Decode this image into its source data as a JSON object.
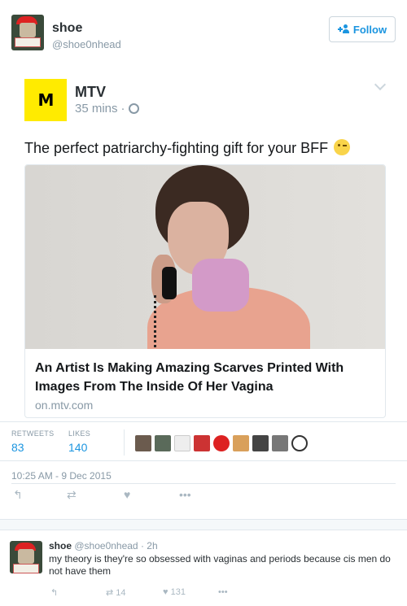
{
  "author": {
    "name": "shoe",
    "handle": "@shoe0nhead"
  },
  "follow_label": "Follow",
  "quoted": {
    "logo_text": "M",
    "name": "MTV",
    "time": "35 mins",
    "text": "The perfect patriarchy-fighting gift for your BFF",
    "card": {
      "title": "An Artist Is Making Amazing Scarves Printed With Images From The Inside Of Her Vagina",
      "domain": "on.mtv.com"
    }
  },
  "stats": {
    "retweets_label": "RETWEETS",
    "retweets": "83",
    "likes_label": "LIKES",
    "likes": "140"
  },
  "timestamp": "10:25 AM - 9 Dec 2015",
  "reply": {
    "name": "shoe",
    "handle": "@shoe0nhead",
    "time": "2h",
    "text": "my theory is they're so obsessed with vaginas and periods because cis men do not have them",
    "retweets": "14",
    "likes": "131"
  },
  "colors": {
    "accent": "#1b95e0",
    "mtv_yellow": "#ffeb00"
  }
}
